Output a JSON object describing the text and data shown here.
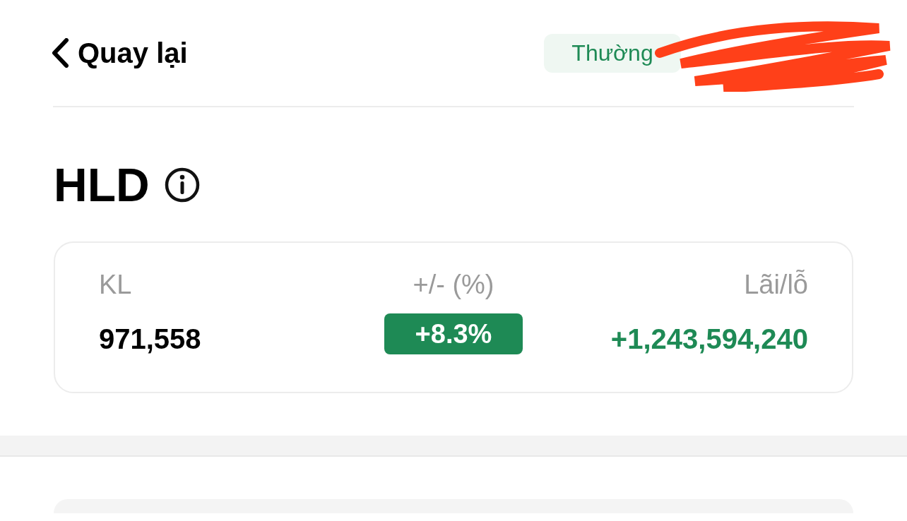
{
  "header": {
    "back_label": "Quay lại",
    "badge": "Thường"
  },
  "symbol": "HLD",
  "summary": [
    {
      "label": "KL",
      "value": "971,558",
      "kind": "plain"
    },
    {
      "label": "+/- (%)",
      "value": "+8.3%",
      "kind": "pill"
    },
    {
      "label": "Lãi/lỗ",
      "value": "+1,243,594,240",
      "kind": "positive"
    }
  ]
}
